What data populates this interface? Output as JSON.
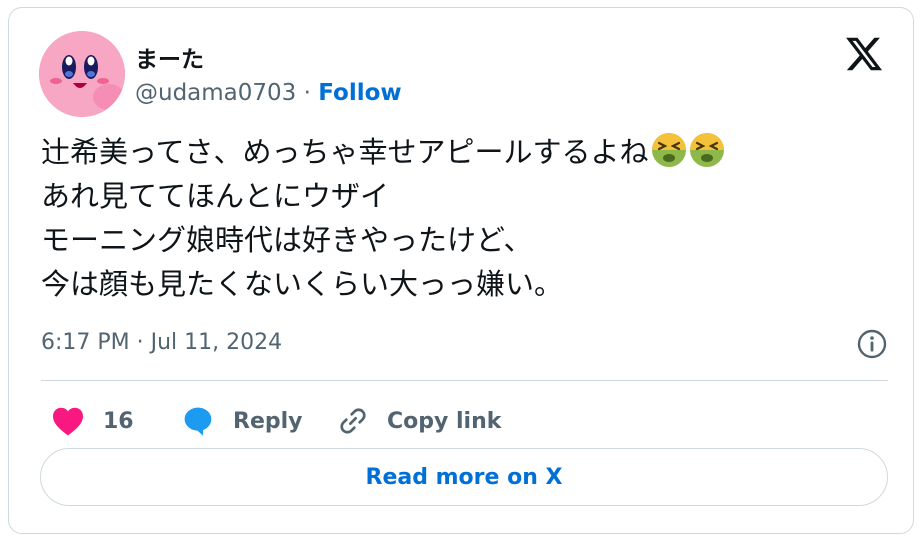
{
  "author": {
    "display_name": "まーた",
    "handle": "@udama0703",
    "separator": "·",
    "follow_label": "Follow",
    "avatar_icon": "kirby-avatar"
  },
  "brand": {
    "logo_icon": "x-logo-icon"
  },
  "tweet": {
    "lines": [
      "辻希美ってさ、めっちゃ幸せアピールするよね",
      "あれ見ててほんとにウザイ",
      "モーニング娘時代は好きやったけど、",
      "今は顔も見たくないくらい大っっ嫌い。"
    ],
    "emojis": [
      "nauseated-face-icon",
      "nauseated-face-icon"
    ],
    "timestamp": "6:17 PM · Jul 11, 2024"
  },
  "actions": {
    "like_count": "16",
    "reply_label": "Reply",
    "copy_link_label": "Copy link"
  },
  "footer": {
    "read_more_label": "Read more on X"
  },
  "colors": {
    "accent": "#006fd6",
    "like": "#f91880",
    "reply": "#1d9bf0",
    "text": "#0f1419",
    "secondary": "#536471",
    "border": "#cfd9de"
  }
}
